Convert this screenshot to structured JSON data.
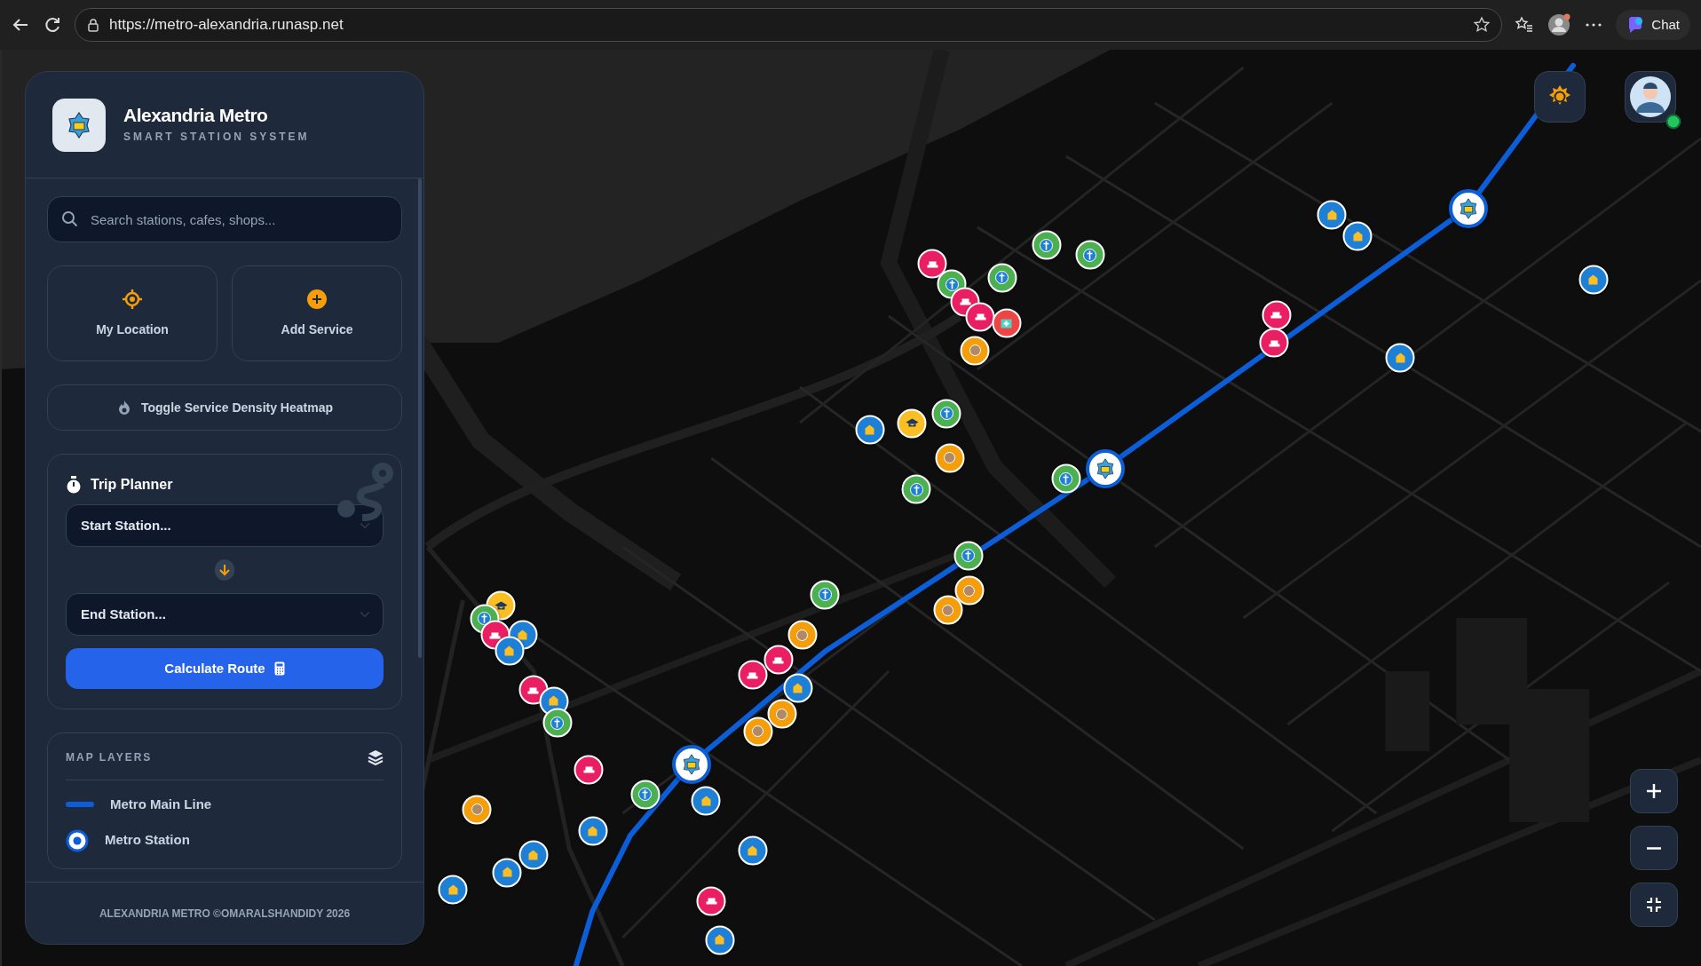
{
  "browser": {
    "url": "https://metro-alexandria.runasp.net",
    "chat_label": "Chat"
  },
  "sidebar": {
    "title": "Alexandria Metro",
    "subtitle": "SMART STATION SYSTEM",
    "search": {
      "placeholder": "Search stations, cafes, shops..."
    },
    "actions": [
      {
        "label": "My Location",
        "kind": "locate"
      },
      {
        "label": "Add Service",
        "kind": "add"
      }
    ],
    "heatmap_button": "Toggle Service Density Heatmap",
    "trip_planner": {
      "title": "Trip Planner",
      "start": "Start Station...",
      "end": "End Station...",
      "button": "Calculate Route"
    },
    "map_layers": {
      "title": "MAP LAYERS",
      "items": [
        {
          "label": "Metro Main Line",
          "kind": "line"
        },
        {
          "label": "Metro Station",
          "kind": "station"
        }
      ]
    },
    "footer": "ALEXANDRIA METRO ©OMARALSHANDIDY 2026"
  },
  "user": {
    "online": true
  },
  "markers": [
    {
      "kind": "station"
    },
    {
      "kind": "shop",
      "color": "#1e7fd6"
    },
    {
      "kind": "shop",
      "color": "#1e7fd6"
    },
    {
      "kind": "shop",
      "color": "#1e7fd6"
    },
    {
      "kind": "shop",
      "color": "#1e7fd6"
    },
    {
      "kind": "restaurant",
      "color": "#e91e63"
    },
    {
      "kind": "restaurant",
      "color": "#e91e63"
    },
    {
      "kind": "pharmacy",
      "color": "#4caf50"
    },
    {
      "kind": "pharmacy",
      "color": "#4caf50"
    },
    {
      "kind": "restaurant",
      "color": "#e91e63"
    },
    {
      "kind": "pharmacy",
      "color": "#4caf50"
    },
    {
      "kind": "pharmacy",
      "color": "#4caf50"
    },
    {
      "kind": "restaurant",
      "color": "#e91e63"
    },
    {
      "kind": "restaurant",
      "color": "#e91e63"
    },
    {
      "kind": "hospital",
      "color": "#ef4444"
    },
    {
      "kind": "cafe",
      "color": "#f59e0b"
    },
    {
      "kind": "pharmacy",
      "color": "#4caf50"
    },
    {
      "kind": "school",
      "color": "#fbbf24"
    },
    {
      "kind": "shop",
      "color": "#1e7fd6"
    },
    {
      "kind": "cafe",
      "color": "#f59e0b"
    },
    {
      "kind": "pharmacy",
      "color": "#4caf50"
    },
    {
      "kind": "pharmacy",
      "color": "#4caf50"
    },
    {
      "kind": "station"
    },
    {
      "kind": "pharmacy",
      "color": "#4caf50"
    },
    {
      "kind": "cafe",
      "color": "#f59e0b"
    },
    {
      "kind": "cafe",
      "color": "#f59e0b"
    },
    {
      "kind": "pharmacy",
      "color": "#4caf50"
    },
    {
      "kind": "cafe",
      "color": "#f59e0b"
    },
    {
      "kind": "restaurant",
      "color": "#e91e63"
    },
    {
      "kind": "restaurant",
      "color": "#e91e63"
    },
    {
      "kind": "shop",
      "color": "#1e7fd6"
    },
    {
      "kind": "cafe",
      "color": "#f59e0b"
    },
    {
      "kind": "cafe",
      "color": "#f59e0b"
    },
    {
      "kind": "school",
      "color": "#fbbf24"
    },
    {
      "kind": "pharmacy",
      "color": "#4caf50"
    },
    {
      "kind": "restaurant",
      "color": "#e91e63"
    },
    {
      "kind": "shop",
      "color": "#1e7fd6"
    },
    {
      "kind": "shop",
      "color": "#1e7fd6"
    },
    {
      "kind": "restaurant",
      "color": "#e91e63"
    },
    {
      "kind": "shop",
      "color": "#1e7fd6"
    },
    {
      "kind": "pharmacy",
      "color": "#4caf50"
    },
    {
      "kind": "restaurant",
      "color": "#e91e63"
    },
    {
      "kind": "station"
    },
    {
      "kind": "pharmacy",
      "color": "#4caf50"
    },
    {
      "kind": "shop",
      "color": "#1e7fd6"
    },
    {
      "kind": "cafe",
      "color": "#f59e0b"
    },
    {
      "kind": "shop",
      "color": "#1e7fd6"
    },
    {
      "kind": "shop",
      "color": "#1e7fd6"
    },
    {
      "kind": "shop",
      "color": "#1e7fd6"
    },
    {
      "kind": "shop",
      "color": "#1e7fd6"
    },
    {
      "kind": "shop",
      "color": "#1e7fd6"
    },
    {
      "kind": "restaurant",
      "color": "#e91e63"
    },
    {
      "kind": "shop",
      "color": "#1e7fd6"
    }
  ]
}
